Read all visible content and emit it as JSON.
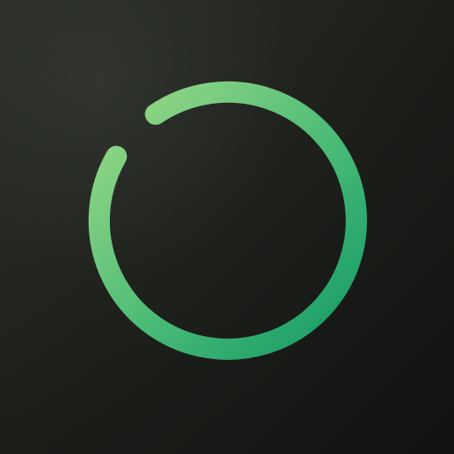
{
  "app_icon": {
    "icon_name": "circular-progress-ring-icon",
    "colors": {
      "background_dark": "#111210",
      "background_light": "#2a2d27",
      "ring_start": "#9ad987",
      "ring_end": "#129866"
    }
  }
}
